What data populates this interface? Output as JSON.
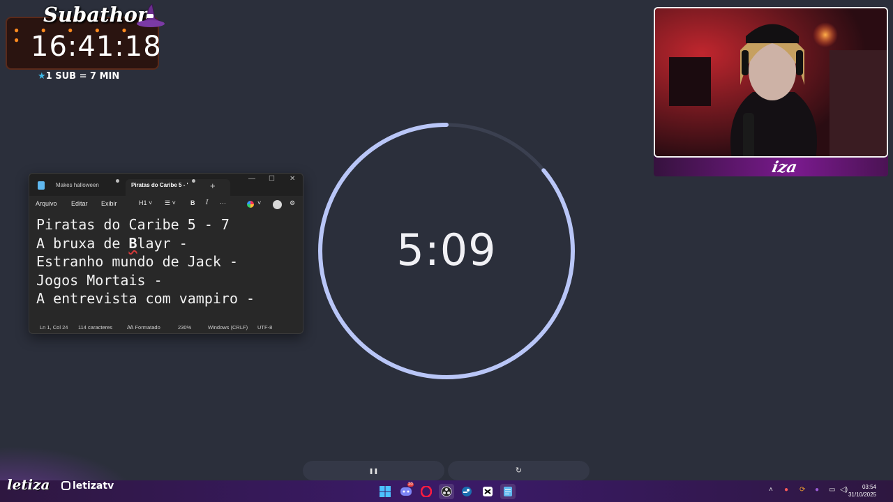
{
  "subathon": {
    "title": "Subathon",
    "timer": "16:41:18",
    "rate": "1 SUB = 7 MIN"
  },
  "notepad": {
    "tabs": [
      {
        "label": "Makes halloween"
      },
      {
        "label": "Piratas do Caribe 5 - '"
      }
    ],
    "menu": [
      "Arquivo",
      "Editar",
      "Exibir"
    ],
    "toolbar": {
      "heading": "H1",
      "bold": "B",
      "italic": "I",
      "more": "···"
    },
    "lines": [
      "Piratas do Caribe 5 - 7",
      "A bruxa de ",
      "Estranho mundo de Jack -",
      "Jogos Mortais -",
      "A entrevista com vampiro -"
    ],
    "line2_bold": "B",
    "line2_rest": "layr -",
    "status": {
      "position": "Ln 1, Col 24",
      "chars": "114 caracteres",
      "format": "Formatado",
      "zoom": "230%",
      "line_ending": "Windows (CRLF)",
      "encoding": "UTF-8"
    }
  },
  "timer": {
    "display": "5:09",
    "progress_fraction": 0.86,
    "ring_color": "#b9c6f7",
    "track_color": "#3b4050"
  },
  "webcam": {
    "name": "iza"
  },
  "controls": {
    "pause_icon": "❚❚",
    "reset_icon": "↻"
  },
  "branding": {
    "logo": "letiza",
    "social": "letizatv"
  },
  "taskbar": {
    "time": "03:54",
    "date": "31/10/2025",
    "discord_badge": "20"
  }
}
